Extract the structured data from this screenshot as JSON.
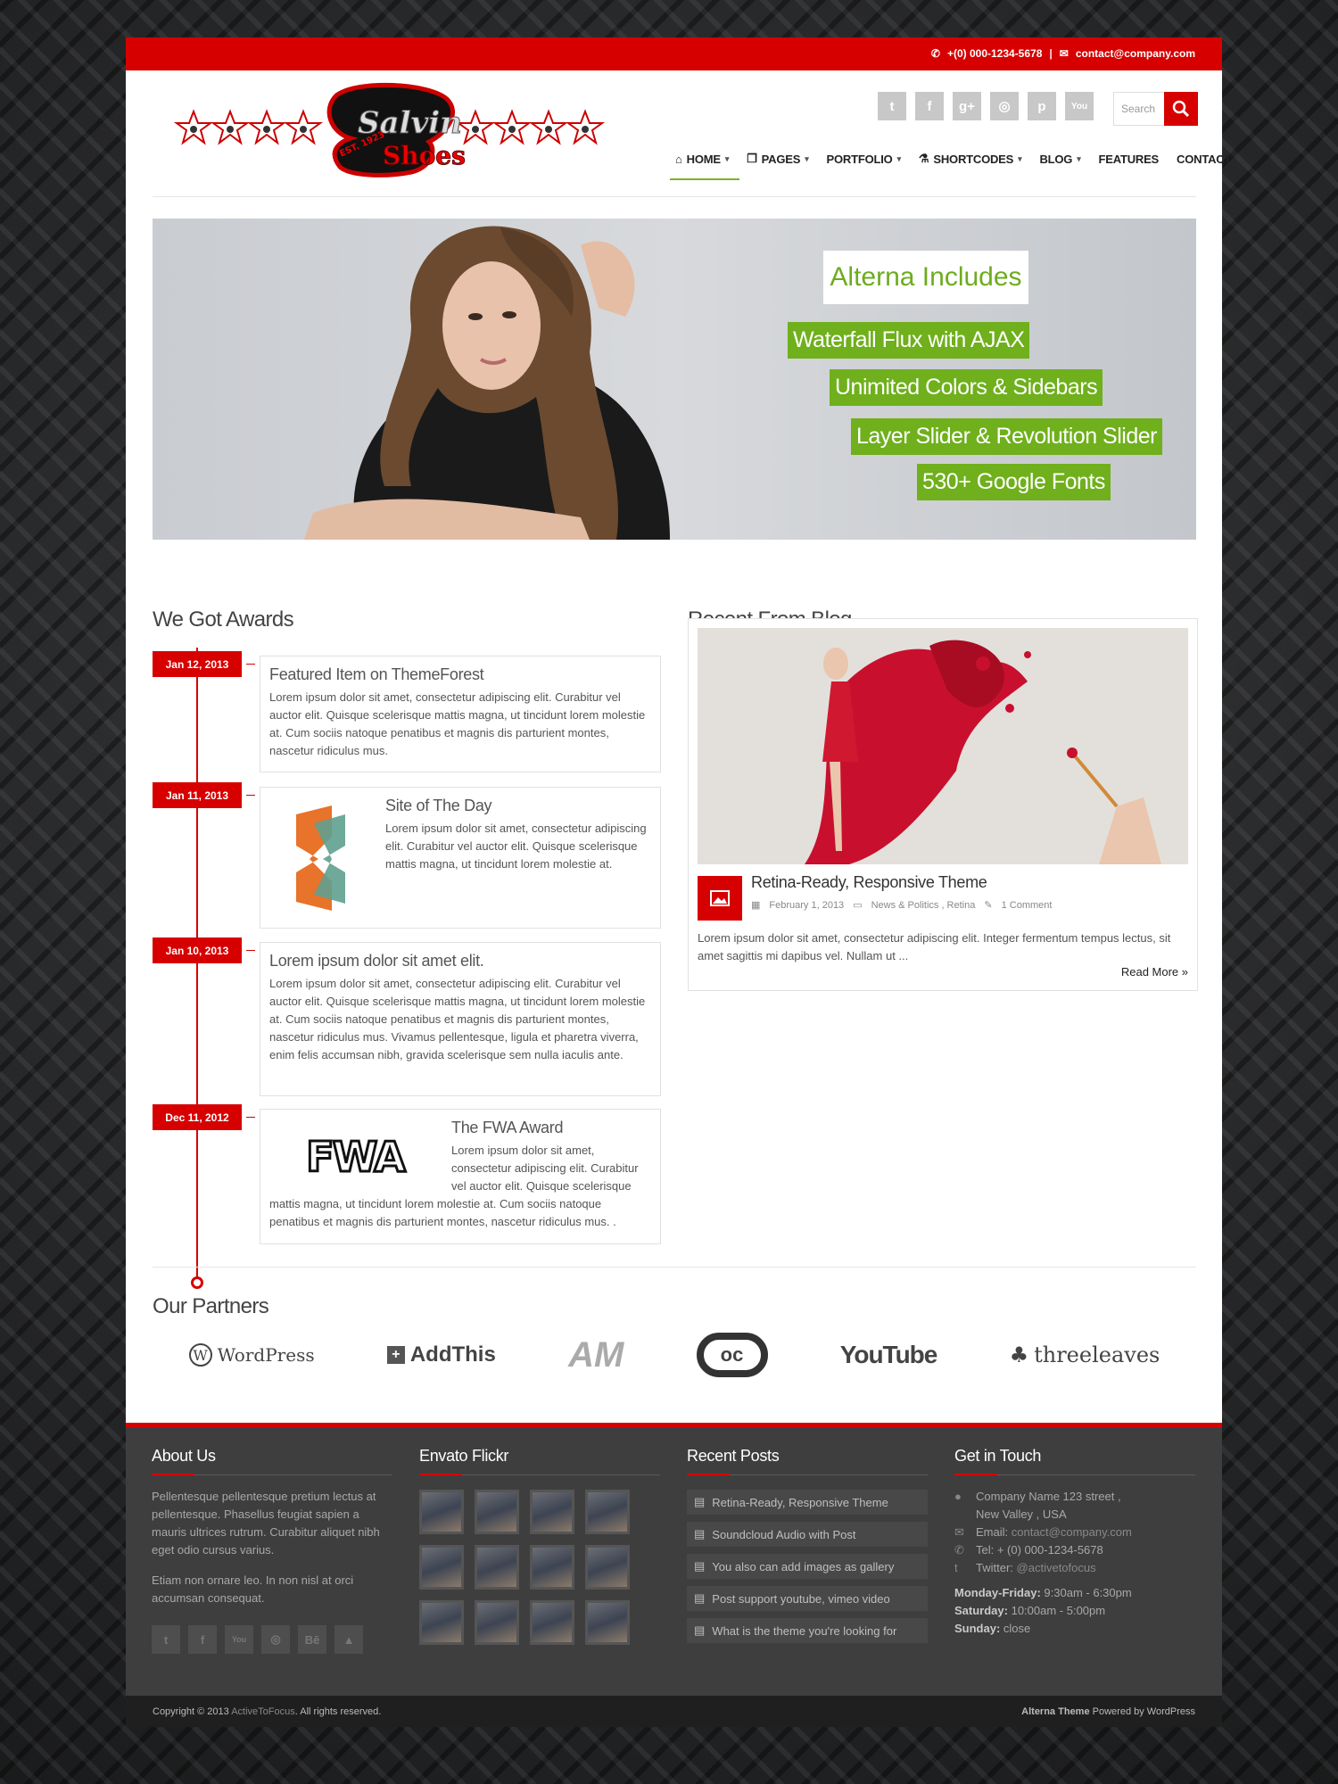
{
  "topbar": {
    "phone": "+(0) 000-1234-5678",
    "separator": "|",
    "email": "contact@company.com"
  },
  "brand": {
    "name_line1": "Salvin",
    "name_line2": "Shoes",
    "est": "EST. 1923"
  },
  "social_top": [
    "twitter-icon",
    "facebook-icon",
    "google-plus-icon",
    "dribbble-icon",
    "pinterest-icon",
    "youtube-icon"
  ],
  "search": {
    "placeholder": "Search"
  },
  "nav": {
    "home": "HOME",
    "pages": "PAGES",
    "portfolio": "PORTFOLIO",
    "shortcodes": "SHORTCODES",
    "blog": "BLOG",
    "features": "FEATURES",
    "contact": "CONTACT"
  },
  "slider": {
    "title": "Alterna Includes",
    "lines": [
      "Waterfall Flux with AJAX",
      "Unimited Colors & Sidebars",
      "Layer Slider & Revolution Slider",
      "530+ Google Fonts"
    ]
  },
  "awards": {
    "heading": "We Got Awards",
    "items": [
      {
        "date": "Jan 12, 2013",
        "title": "Featured Item on ThemeForest",
        "text": "Lorem ipsum dolor sit amet, consectetur adipiscing elit. Curabitur vel auctor elit. Quisque scelerisque mattis magna, ut tincidunt lorem molestie at. Cum sociis natoque penatibus et magnis dis parturient montes, nascetur ridiculus mus."
      },
      {
        "date": "Jan 11, 2013",
        "title": "Site of The Day",
        "text": "Lorem ipsum dolor sit amet, consectetur adipiscing elit. Curabitur vel auctor elit. Quisque scelerisque mattis magna, ut tincidunt lorem molestie at."
      },
      {
        "date": "Jan 10, 2013",
        "title": "Lorem ipsum dolor sit amet elit.",
        "text": "Lorem ipsum dolor sit amet, consectetur adipiscing elit. Curabitur vel auctor elit. Quisque scelerisque mattis magna, ut tincidunt lorem molestie at. Cum sociis natoque penatibus et magnis dis parturient montes, nascetur ridiculus mus. Vivamus pellentesque, ligula et pharetra viverra, enim felis accumsan nibh, gravida scelerisque sem nulla iaculis ante."
      },
      {
        "date": "Dec 11, 2012",
        "title": "The FWA Award",
        "text": "Lorem ipsum dolor sit amet, consectetur adipiscing elit. Curabitur vel auctor elit. Quisque scelerisque mattis magna, ut tincidunt lorem molestie at. Cum sociis natoque penatibus et magnis dis parturient montes, nascetur ridiculus mus. .",
        "logo_text": "FWA"
      }
    ]
  },
  "blog": {
    "heading": "Recent From Blog",
    "title": "Retina-Ready, Responsive Theme",
    "date": "February 1, 2013",
    "categories": "News & Politics , Retina",
    "comments": "1 Comment",
    "excerpt": "Lorem ipsum dolor sit amet, consectetur adipiscing elit. Integer fermentum tempus lectus, sit amet sagittis mi dapibus vel. Nullam ut ...",
    "read_more": "Read More »"
  },
  "partners": {
    "heading": "Our Partners",
    "items": [
      "WordPress",
      "AddThis",
      "AM",
      "oc",
      "YouTube",
      "threeleaves"
    ]
  },
  "footer": {
    "about": {
      "heading": "About Us",
      "p1": "Pellentesque pellentesque pretium lectus at pellentesque. Phasellus feugiat sapien a mauris ultrices rutrum. Curabitur aliquet nibh eget odio cursus varius.",
      "p2": "Etiam non ornare leo. In non nisl at orci accumsan consequat.",
      "social": [
        "twitter-icon",
        "facebook-icon",
        "youtube-icon",
        "dribbble-icon",
        "behance-icon",
        "envato-icon"
      ]
    },
    "flickr": {
      "heading": "Envato Flickr"
    },
    "recent": {
      "heading": "Recent Posts",
      "posts": [
        "Retina-Ready, Responsive Theme",
        "Soundcloud Audio with Post",
        "You also can add images as gallery",
        "Post support youtube, vimeo video",
        "What is the theme you're looking for"
      ]
    },
    "touch": {
      "heading": "Get in Touch",
      "address1": "Company Name 123 street ,",
      "address2": "New Valley , USA",
      "email_label": "Email:",
      "email": "contact@company.com",
      "tel": "Tel: + (0) 000-1234-5678",
      "twitter_label": "Twitter:",
      "twitter": "@activetofocus",
      "hours": [
        {
          "day": "Monday-Friday:",
          "time": "9:30am - 6:30pm"
        },
        {
          "day": "Saturday:",
          "time": "10:00am - 5:00pm"
        },
        {
          "day": "Sunday:",
          "time": "close"
        }
      ]
    }
  },
  "copyright": {
    "prefix": "Copyright © 2013",
    "company": "ActiveToFocus",
    "suffix": ". All rights reserved.",
    "theme": "Alterna Theme",
    "powered": "Powered by WordPress"
  },
  "colors": {
    "accent": "#d60000",
    "green": "#6fb01c",
    "footer": "#3e3e3f"
  }
}
